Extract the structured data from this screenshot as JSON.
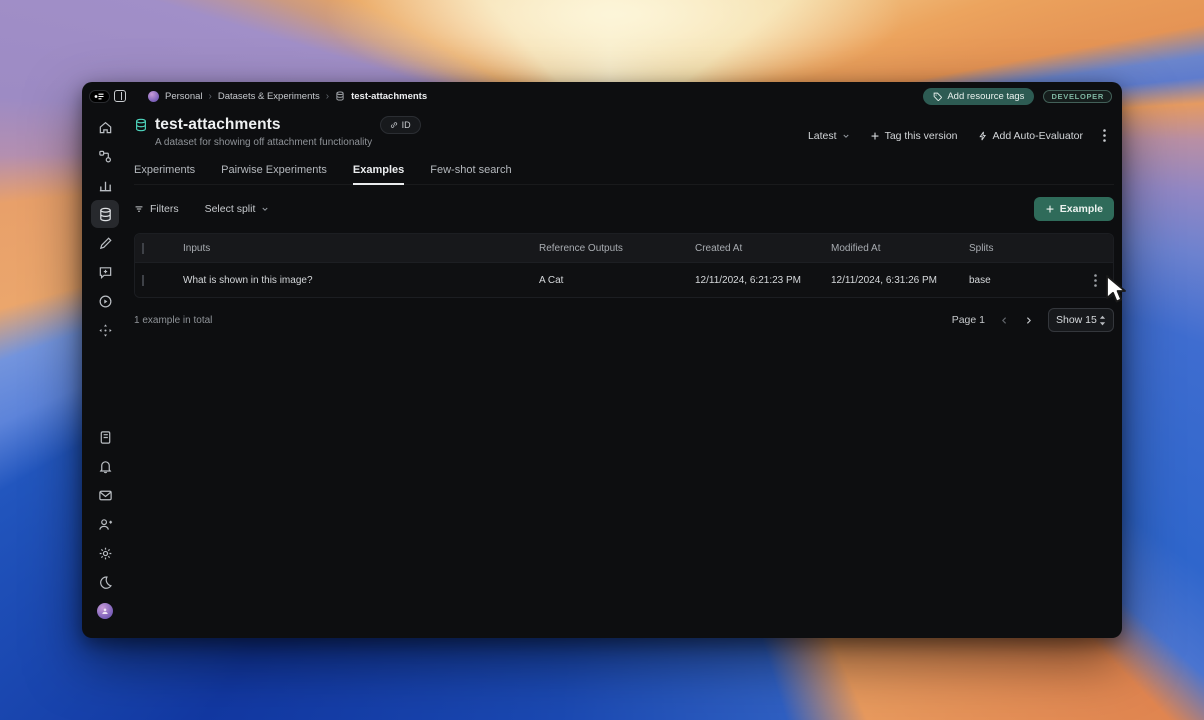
{
  "topbar": {
    "breadcrumb": {
      "org": "Personal",
      "section": "Datasets & Experiments",
      "page": "test-attachments",
      "separator": "›"
    },
    "add_resource_tags_label": "Add resource tags",
    "role_badge": "DEVELOPER"
  },
  "header": {
    "title": "test-attachments",
    "subtitle": "A dataset for showing off attachment functionality",
    "id_badge": "ID",
    "version_selector": "Latest",
    "tag_version_label": "Tag this version",
    "auto_evaluator_label": "Add Auto-Evaluator"
  },
  "tabs": {
    "items": [
      "Experiments",
      "Pairwise Experiments",
      "Examples",
      "Few-shot search"
    ],
    "active": "Examples"
  },
  "toolbar": {
    "filters_label": "Filters",
    "select_split_label": "Select split",
    "add_example_label": "Example"
  },
  "table": {
    "columns": [
      "Inputs",
      "Reference Outputs",
      "Created At",
      "Modified At",
      "Splits"
    ],
    "rows": [
      {
        "inputs": "What is shown in this image?",
        "reference_outputs": "A Cat",
        "created_at": "12/11/2024, 6:21:23 PM",
        "modified_at": "12/11/2024, 6:31:26 PM",
        "splits": "base"
      }
    ]
  },
  "footer": {
    "total_label": "1 example in total",
    "page_label": "Page 1",
    "page_size_label": "Show 15"
  },
  "sidebar": {
    "icons_top": [
      "home",
      "workflow",
      "bar-chart",
      "database",
      "pencil",
      "chat-plus",
      "play-circle",
      "move"
    ],
    "icons_bottom": [
      "notebook",
      "bell",
      "mail",
      "user-plus",
      "gear",
      "moon"
    ],
    "active_icon": "database"
  },
  "colors": {
    "teal_pill": "#2d5b53",
    "green_button": "#2f6b5a",
    "badge_text": "#7db39f",
    "window_bg": "#0d0e10",
    "table_header_bg": "#17181b"
  }
}
